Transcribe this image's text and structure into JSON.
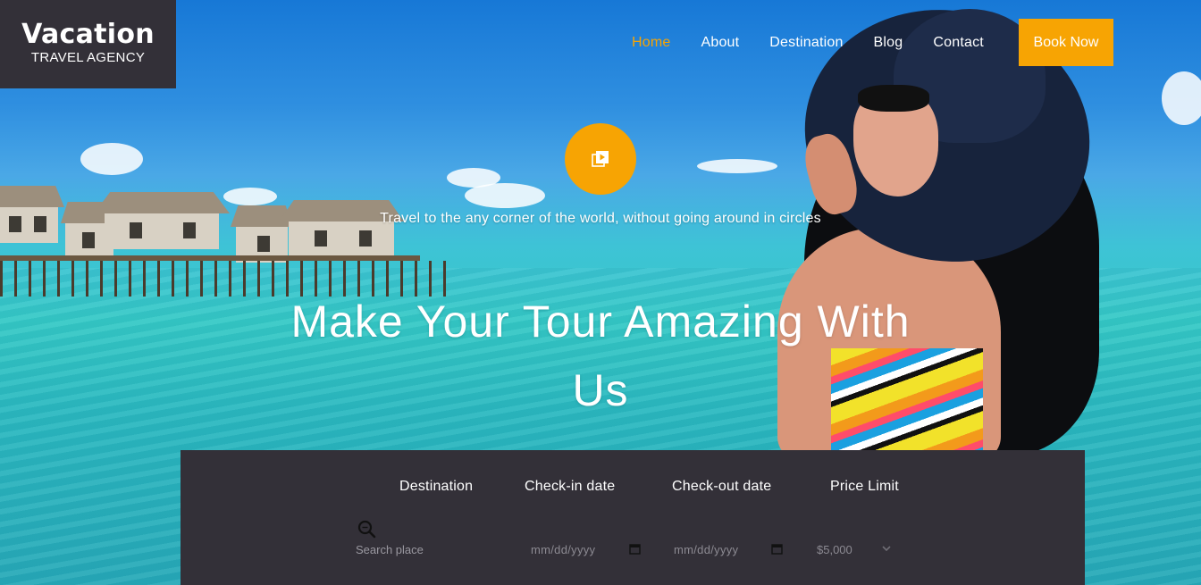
{
  "brand": {
    "name": "Vacation",
    "tagline": "TRAVEL AGENCY"
  },
  "nav": {
    "items": [
      {
        "label": "Home",
        "active": true
      },
      {
        "label": "About",
        "active": false
      },
      {
        "label": "Destination",
        "active": false
      },
      {
        "label": "Blog",
        "active": false
      },
      {
        "label": "Contact",
        "active": false
      }
    ],
    "cta_label": "Book Now"
  },
  "hero": {
    "play_icon": "video-play-icon",
    "tagline": "Travel to the any corner of the world, without going around in circles",
    "headline_line1": "Make Your Tour Amazing With",
    "headline_line2": "Us"
  },
  "search": {
    "labels": {
      "destination": "Destination",
      "checkin": "Check-in date",
      "checkout": "Check-out date",
      "price": "Price Limit"
    },
    "destination_placeholder": "Search place",
    "checkin_value": "mm/dd/yyyy",
    "checkout_value": "mm/dd/yyyy",
    "price_selected": "$5,000",
    "icons": {
      "search": "search-icon",
      "calendar": "calendar-icon",
      "dropdown": "chevron-down-icon"
    }
  },
  "colors": {
    "accent": "#f7a403",
    "panel": "#333038",
    "text": "#ffffff"
  }
}
